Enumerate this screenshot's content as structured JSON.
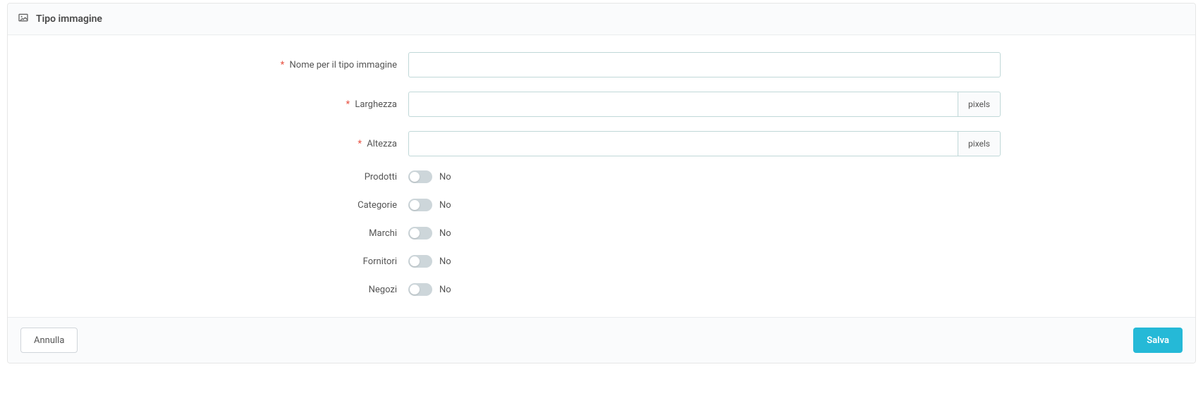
{
  "panel": {
    "title": "Tipo immagine"
  },
  "fields": {
    "name": {
      "label": "Nome per il tipo immagine",
      "value": ""
    },
    "width": {
      "label": "Larghezza",
      "value": "",
      "unit": "pixels"
    },
    "height": {
      "label": "Altezza",
      "value": "",
      "unit": "pixels"
    }
  },
  "toggles": {
    "products": {
      "label": "Prodotti",
      "state_label": "No"
    },
    "categories": {
      "label": "Categorie",
      "state_label": "No"
    },
    "brands": {
      "label": "Marchi",
      "state_label": "No"
    },
    "suppliers": {
      "label": "Fornitori",
      "state_label": "No"
    },
    "stores": {
      "label": "Negozi",
      "state_label": "No"
    }
  },
  "footer": {
    "cancel": "Annulla",
    "save": "Salva"
  }
}
